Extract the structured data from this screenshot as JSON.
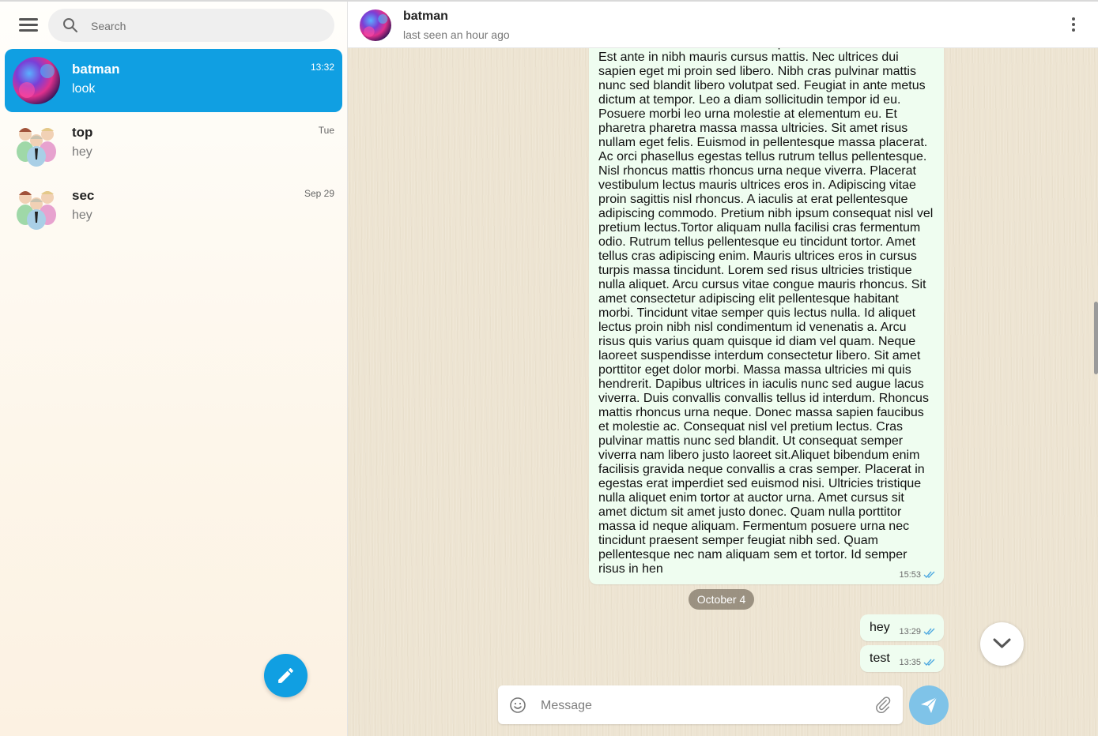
{
  "search": {
    "placeholder": "Search"
  },
  "chats": [
    {
      "name": "batman",
      "preview": "look",
      "time": "13:32",
      "active": true,
      "avatar": "gradient-avatar"
    },
    {
      "name": "top",
      "preview": "hey",
      "time": "Tue",
      "active": false,
      "avatar": "group-avatar"
    },
    {
      "name": "sec",
      "preview": "hey",
      "time": "Sep 29",
      "active": false,
      "avatar": "group-avatar"
    }
  ],
  "header": {
    "name": "batman",
    "status": "last seen an hour ago"
  },
  "messages": {
    "long": {
      "text": "fermentum iaculis eu non. Tristique senectus et netus et. Est ante in nibh mauris cursus mattis. Nec ultrices dui sapien eget mi proin sed libero. Nibh cras pulvinar mattis nunc sed blandit libero volutpat sed. Feugiat in ante metus dictum at tempor. Leo a diam sollicitudin tempor id eu. Posuere morbi leo urna molestie at elementum eu. Et pharetra pharetra massa massa ultricies. Sit amet risus nullam eget felis. Euismod in pellentesque massa placerat. Ac orci phasellus egestas tellus rutrum tellus pellentesque. Nisl rhoncus mattis rhoncus urna neque viverra. Placerat vestibulum lectus mauris ultrices eros in. Adipiscing vitae proin sagittis nisl rhoncus. A iaculis at erat pellentesque adipiscing commodo. Pretium nibh ipsum consequat nisl vel pretium lectus.Tortor aliquam nulla facilisi cras fermentum odio. Rutrum tellus pellentesque eu tincidunt tortor. Amet tellus cras adipiscing enim. Mauris ultrices eros in cursus turpis massa tincidunt. Lorem sed risus ultricies tristique nulla aliquet. Arcu cursus vitae congue mauris rhoncus. Sit amet consectetur adipiscing elit pellentesque habitant morbi. Tincidunt vitae semper quis lectus nulla. Id aliquet lectus proin nibh nisl condimentum id venenatis a. Arcu risus quis varius quam quisque id diam vel quam. Neque laoreet suspendisse interdum consectetur libero. Sit amet porttitor eget dolor morbi. Massa massa ultricies mi quis hendrerit. Dapibus ultrices in iaculis nunc sed augue lacus viverra. Duis convallis convallis tellus id interdum. Rhoncus mattis rhoncus urna neque. Donec massa sapien faucibus et molestie ac. Consequat nisl vel pretium lectus. Cras pulvinar mattis nunc sed blandit. Ut consequat semper viverra nam libero justo laoreet sit.Aliquet bibendum enim facilisis gravida neque convallis a cras semper. Placerat in egestas erat imperdiet sed euismod nisi. Ultricies tristique nulla aliquet enim tortor at auctor urna. Amet cursus sit amet dictum sit amet justo donec. Quam nulla porttitor massa id neque aliquam. Fermentum posuere urna nec tincidunt praesent semper feugiat nibh sed. Quam pellentesque nec nam aliquam sem et tortor. Id semper risus in hen",
      "time": "15:53"
    },
    "date_separator": "October 4",
    "short": [
      {
        "text": "hey",
        "time": "13:29"
      },
      {
        "text": "test",
        "time": "13:35"
      }
    ]
  },
  "composer": {
    "placeholder": "Message"
  },
  "colors": {
    "accent": "#109fe2",
    "bubble": "#effdf0",
    "tick": "#4fa9e0"
  }
}
